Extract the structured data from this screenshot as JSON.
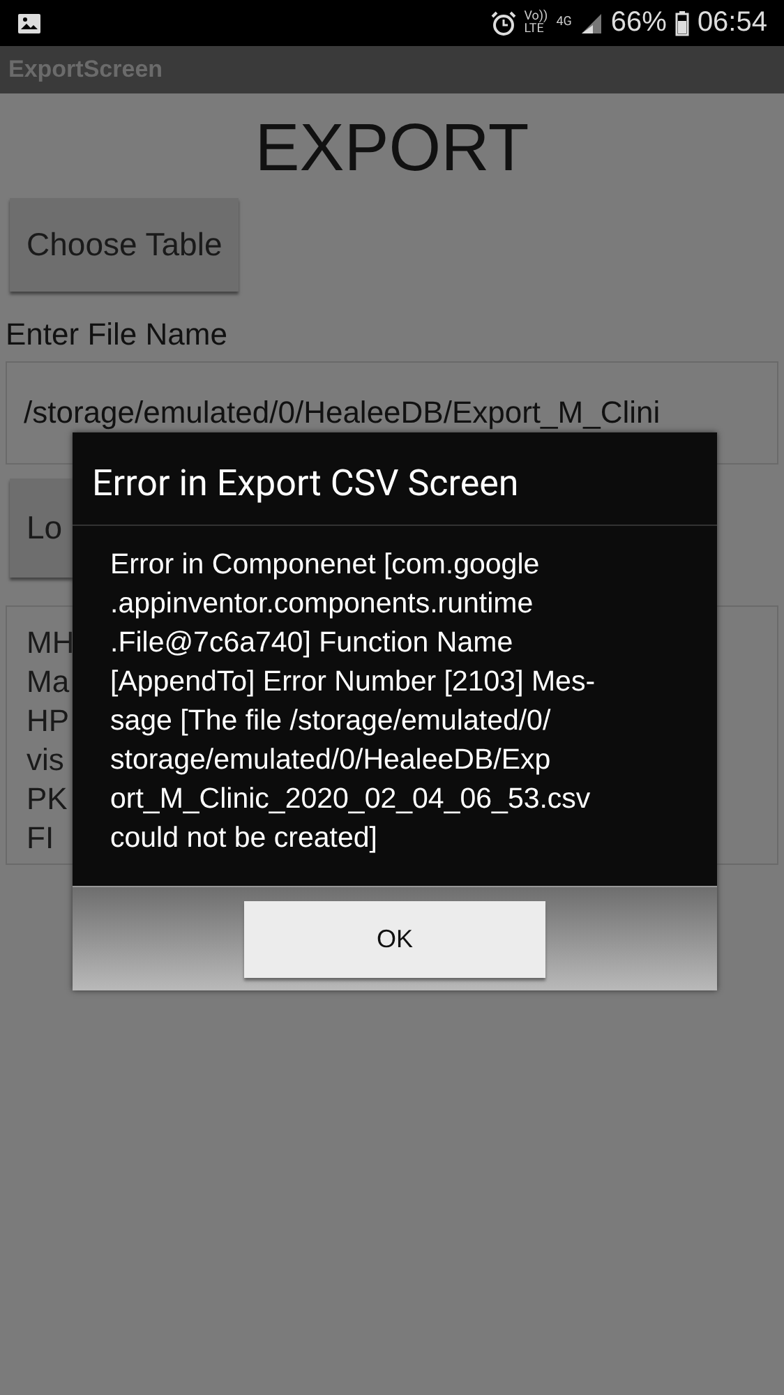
{
  "status_bar": {
    "volte": "Vo))",
    "lte": "LTE",
    "network": "4G",
    "battery": "66%",
    "time": "06:54"
  },
  "window": {
    "title": "ExportScreen"
  },
  "heading": "EXPORT",
  "choose_button": "Choose Table",
  "file_label": "Enter File Name",
  "file_field": {
    "value": "/storage/emulated/0/HealeeDB/Export_M_Clini"
  },
  "load_button": "Lo",
  "list_lines": [
    "MH",
    "Ma",
    "HP",
    "vis",
    "PK",
    "FI"
  ],
  "dialog": {
    "title": "Error in Export CSV Screen",
    "message": "Error in Componenet [com.google\n.appinventor.components.runtime\n.File@7c6a740] Function Name\n[AppendTo] Error Number [2103] Mes-\nsage [The file /storage/emulated/0/\nstorage/emulated/0/HealeeDB/Exp\nort_M_Clinic_2020_02_04_06_53.csv\ncould not be created]",
    "button": "OK"
  }
}
